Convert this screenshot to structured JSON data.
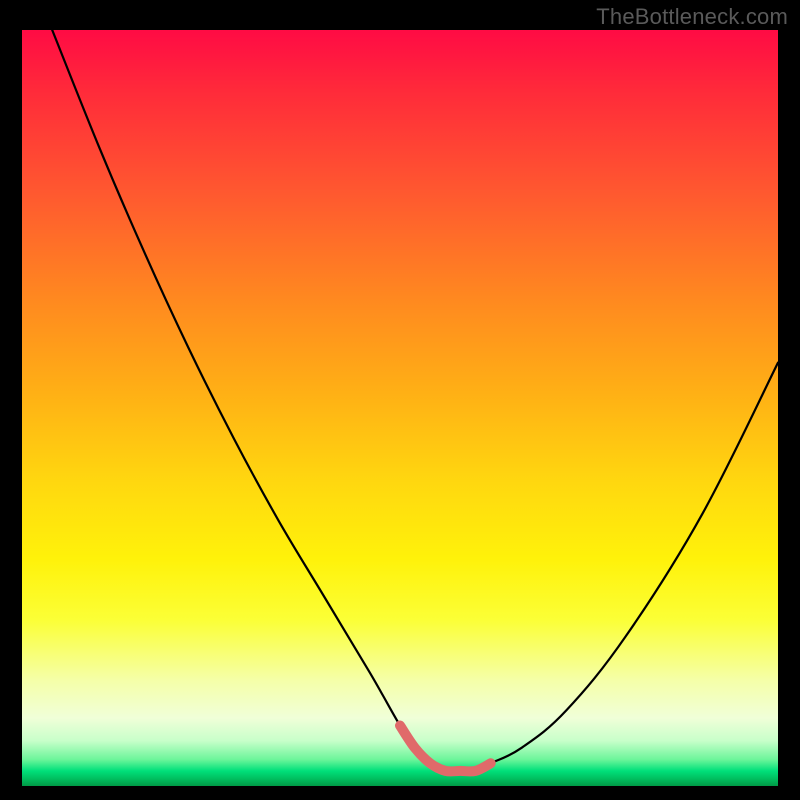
{
  "watermark": "TheBottleneck.com",
  "colors": {
    "frame_background": "#000000",
    "watermark_text": "#5a5a5a",
    "curve": "#000000",
    "highlight_segment": "#e06a6a",
    "gradient_stops": [
      "#ff0b44",
      "#ff2a3a",
      "#ff5a2f",
      "#ff8a1f",
      "#ffb015",
      "#ffd80f",
      "#fff20a",
      "#fbff36",
      "#f5ffa8",
      "#f0ffd8",
      "#c8ffca",
      "#6cf59a",
      "#00e07a",
      "#00c060",
      "#009a46"
    ]
  },
  "chart_data": {
    "type": "line",
    "title": "",
    "xlabel": "",
    "ylabel": "",
    "xlim": [
      0,
      100
    ],
    "ylim": [
      0,
      100
    ],
    "grid": false,
    "series": [
      {
        "name": "bottleneck-curve",
        "x": [
          4,
          10,
          16,
          22,
          28,
          34,
          40,
          46,
          50,
          52,
          54,
          56,
          58,
          60,
          62,
          66,
          72,
          80,
          90,
          100
        ],
        "values": [
          100,
          85,
          71,
          58,
          46,
          35,
          25,
          15,
          8,
          5,
          3,
          2,
          2,
          2,
          3,
          5,
          10,
          20,
          36,
          56
        ]
      }
    ],
    "annotations": [
      {
        "name": "optimal-range-highlight",
        "x_range": [
          50,
          62
        ],
        "y_approx": 3
      }
    ],
    "background": "vertical-gradient-red-to-green"
  }
}
